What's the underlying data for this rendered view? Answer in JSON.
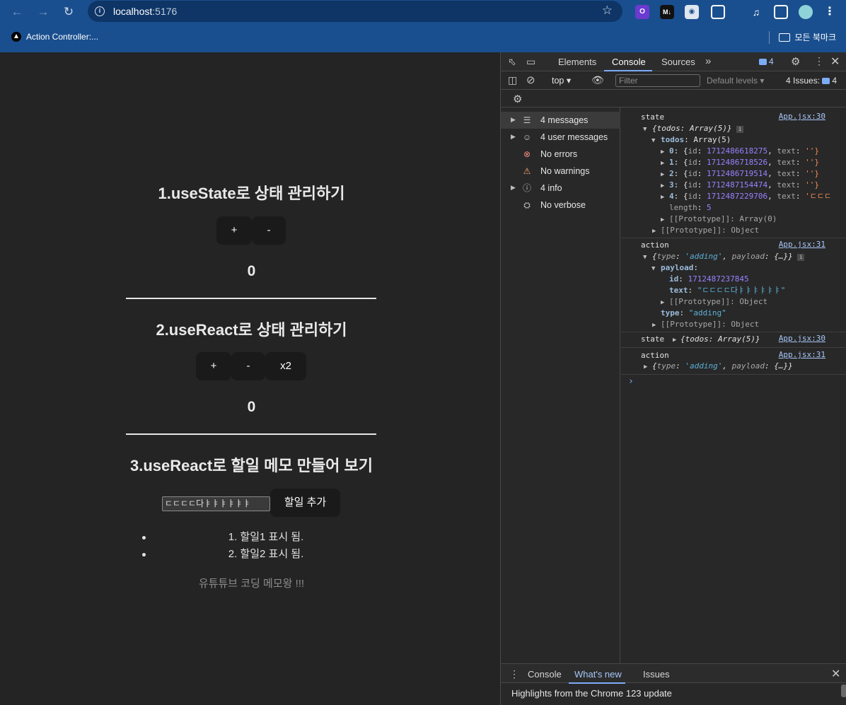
{
  "browser": {
    "url_host": "localhost",
    "url_port": ":5176",
    "bookmark": "Action Controller:...",
    "all_bookmarks": "모든 북마크",
    "ext_labels": [
      "O",
      "M↓"
    ]
  },
  "app": {
    "section1_title": "1.useState로 상태 관리하기",
    "section1_buttons": [
      "+",
      "-"
    ],
    "section1_count": "0",
    "section2_title": "2.useReact로 상태 관리하기",
    "section2_buttons": [
      "+",
      "-",
      "x2"
    ],
    "section2_count": "0",
    "section3_title": "3.useReact로 할일 메모 만들어 보기",
    "input_value": "ㄷㄷㄷㄷ다ㅑㅑㅑㅑㅑㅑ",
    "add_button": "할일 추가",
    "todos": [
      "1. 할일1 표시 됨.",
      "2. 할일2 표시 됨."
    ],
    "footer": "유튜튜브 코딩 메모왕 !!!"
  },
  "devtools": {
    "tabs": [
      "Elements",
      "Console",
      "Sources"
    ],
    "active_tab": "Console",
    "message_badge": "4",
    "context": "top",
    "filter_placeholder": "Filter",
    "levels": "Default levels",
    "issues_label": "4 Issues:",
    "issues_count": "4",
    "sidebar": [
      {
        "label": "4 messages",
        "icon": "list-icon",
        "expandable": true
      },
      {
        "label": "4 user messages",
        "icon": "user-icon",
        "expandable": true
      },
      {
        "label": "No errors",
        "icon": "error-icon",
        "expandable": false
      },
      {
        "label": "No warnings",
        "icon": "warning-icon",
        "expandable": false
      },
      {
        "label": "4 info",
        "icon": "info-icon",
        "expandable": true
      },
      {
        "label": "No verbose",
        "icon": "bug-icon",
        "expandable": false
      }
    ],
    "console": {
      "log1_label": "state",
      "log1_src": "App.jsx:30",
      "log1_summary": "{todos: Array(5)}",
      "todos_label": "todos",
      "todos_type": "Array(5)",
      "items": [
        {
          "idx": "0",
          "id": "1712486618275",
          "text": "''}"
        },
        {
          "idx": "1",
          "id": "1712486718526",
          "text": "''}"
        },
        {
          "idx": "2",
          "id": "1712486719514",
          "text": "''}"
        },
        {
          "idx": "3",
          "id": "1712487154474",
          "text": "''}"
        },
        {
          "idx": "4",
          "id": "1712487229706",
          "text": "'ㄷㄷㄷ"
        }
      ],
      "length_label": "length",
      "length_value": "5",
      "proto_array": "[[Prototype]]: Array(0)",
      "proto_object": "[[Prototype]]: Object",
      "log2_label": "action",
      "log2_src": "App.jsx:31",
      "log2_summary_type": "'adding'",
      "payload_label": "payload",
      "payload_id": "1712487237845",
      "payload_text": "\"ㄷㄷㄷㄷ다ㅑㅑㅑㅑㅑㅑ\"",
      "type_label": "type",
      "type_value": "\"adding\"",
      "log3_label": "state",
      "log3_src": "App.jsx:30",
      "log3_summary": "{todos: Array(5)}",
      "log4_label": "action",
      "log4_src": "App.jsx:31",
      "log4_summary_type": "'adding'"
    },
    "drawer_tabs": [
      "Console",
      "What's new",
      "Issues"
    ],
    "drawer_active": "What's new",
    "drawer_text": "Highlights from the Chrome 123 update"
  }
}
